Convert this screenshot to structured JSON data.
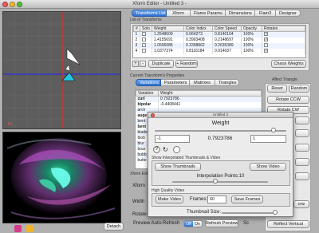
{
  "window": {
    "title": "Xform Editor - Untitled 3 -"
  },
  "tabs": [
    "Transforms List",
    "Xform",
    "Flame Params",
    "Dimensions",
    "Flam3",
    "Designer"
  ],
  "transforms_list": {
    "group_label": "List of Transforms",
    "headers": [
      "#",
      "Solo",
      "Weight",
      "Color Index",
      "Color Speed",
      "Opacity",
      "Rotates"
    ],
    "rows": [
      {
        "num": "1",
        "weight": "1.2548609",
        "color_index": "0.064273",
        "color_speed": "0.8140164",
        "opacity": "100%"
      },
      {
        "num": "2",
        "weight": "1.4155691",
        "color_index": "0.3993408",
        "color_speed": "0.2148697",
        "opacity": "100%"
      },
      {
        "num": "3",
        "weight": "1.0506986",
        "color_index": "0.3398862",
        "color_speed": "0.2635389",
        "opacity": "100%"
      },
      {
        "num": "4",
        "weight": "1.0377374",
        "color_index": "0.8116184",
        "color_speed": "0.914037",
        "opacity": "100%"
      }
    ],
    "add_label": "+",
    "remove_label": "-",
    "duplicate_label": "Duplicate",
    "add_random_label": "+ Random",
    "chaos_label": "Chaos Weights"
  },
  "current_props": {
    "label": "Current Transform's Properties",
    "tabs": [
      "Variations",
      "Parameters",
      "Matrixes",
      "Triangles"
    ],
    "headers": [
      "Variation",
      "Weight"
    ],
    "rows": [
      {
        "name": "curl",
        "weight": "0.7923786"
      },
      {
        "name": "bipolar",
        "weight": "-0.4408441"
      },
      {
        "name": "arch",
        "weight": ""
      },
      {
        "name": "auge",
        "weight": ""
      },
      {
        "name": "bent",
        "weight": ""
      },
      {
        "name": "bent",
        "weight": ""
      },
      {
        "name": "blade",
        "weight": ""
      },
      {
        "name": "blob",
        "weight": ""
      },
      {
        "name": "blur",
        "weight": ""
      },
      {
        "name": "boar",
        "weight": ""
      },
      {
        "name": "bubb",
        "weight": ""
      },
      {
        "name": "butte",
        "weight": ""
      }
    ]
  },
  "affect_triangle": {
    "label": "Affect Triangle",
    "reset_label": "Reset",
    "random_label": "Random",
    "rotate_ccw_label": "Rotate CCW",
    "rotate_cw_label": "Rotate CW",
    "rotate_label": "Rotate",
    "flip_label": "Flip",
    "reflect_vertical_label": "Reflect Vertical",
    "horiz_label": "oriz"
  },
  "xform_editor_partial": {
    "label": "Xform Edi",
    "xform_label": "Xform",
    "width_label": "Width",
    "rotate_label": "Rotate"
  },
  "variation_dialog": {
    "title": "Untitled 3",
    "weight_label": "Weight",
    "min_value": "-1",
    "current_value": "0.7923786",
    "max_value": "1",
    "weight_fraction": 0.9,
    "show_interp_label": "Show Interpolated Thumbnails & Video",
    "show_thumbnails_label": "Show Thumbnails",
    "show_video_label": "Show Video",
    "interp_points_label": "Interpolation Points:10",
    "interp_fraction": 0.45,
    "high_quality_label": "High Quality Video",
    "make_video_label": "Make Video",
    "frames_label": "Frames:",
    "frames_value": "60",
    "save_frames_label": "Save Frames",
    "thumb_size_label": "Thumbnail Size:",
    "thumb_fraction": 0.95
  },
  "bottom": {
    "detach_label": "Detach",
    "preview_label": "Preview Auto-Refresh",
    "off_label": "Off",
    "on_label": "On",
    "refresh_label": "Refresh Preview",
    "status_text": "Sc"
  },
  "canvas_overlay": {
    "coord_label": "Fx"
  },
  "colors": {
    "accent": "#2e6fd0",
    "xaxis": "#2222ff",
    "yaxis": "#ff2020",
    "tri_white": "#ffffff",
    "tri_cyan": "#22c8e6"
  }
}
